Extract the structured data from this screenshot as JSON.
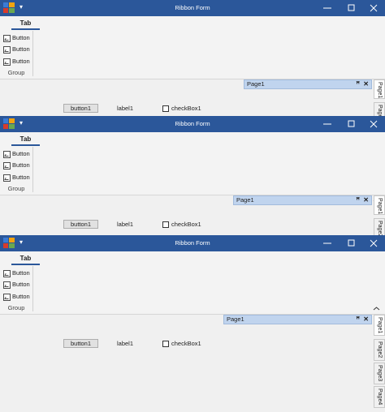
{
  "windows": [
    {
      "title": "Ribbon Form",
      "qat_glyph": "▾",
      "tab_label": "Tab",
      "buttons": [
        "Button",
        "Button",
        "Button"
      ],
      "group_label": "Group",
      "dock_panel": {
        "title": "Page1",
        "pin": "ꟸ",
        "close": "✕"
      },
      "button1": "button1",
      "label1": "label1",
      "checkbox_label": "checkBox1",
      "side_tabs": [
        "Page1",
        "Page2"
      ]
    },
    {
      "title": "Ribbon Form",
      "qat_glyph": "▾",
      "tab_label": "Tab",
      "buttons": [
        "Button",
        "Button",
        "Button"
      ],
      "group_label": "Group",
      "dock_panel": {
        "title": "Page1",
        "pin": "ꟸ",
        "close": "✕"
      },
      "button1": "button1",
      "label1": "label1",
      "checkbox_label": "checkBox1",
      "side_tabs": [
        "Page1",
        "Page2"
      ]
    },
    {
      "title": "Ribbon Form",
      "qat_glyph": "▾",
      "tab_label": "Tab",
      "buttons": [
        "Button",
        "Button",
        "Button"
      ],
      "group_label": "Group",
      "dock_panel": {
        "title": "Page1",
        "pin": "ꟸ",
        "close": "✕"
      },
      "button1": "button1",
      "label1": "label1",
      "checkbox_label": "checkBox1",
      "side_tabs": [
        "Page1",
        "Page2",
        "Page3",
        "Page4"
      ]
    }
  ],
  "colors": {
    "titlebar": "#2b579a",
    "tab_underline": "#2b579a",
    "dock_panel": "#c0d4ee"
  },
  "icons": {
    "app": "app-icon",
    "minimize": "minimize-icon",
    "maximize": "maximize-icon",
    "close": "close-icon",
    "ribbon_button": "image-icon",
    "collapse": "chevron-up-icon"
  }
}
